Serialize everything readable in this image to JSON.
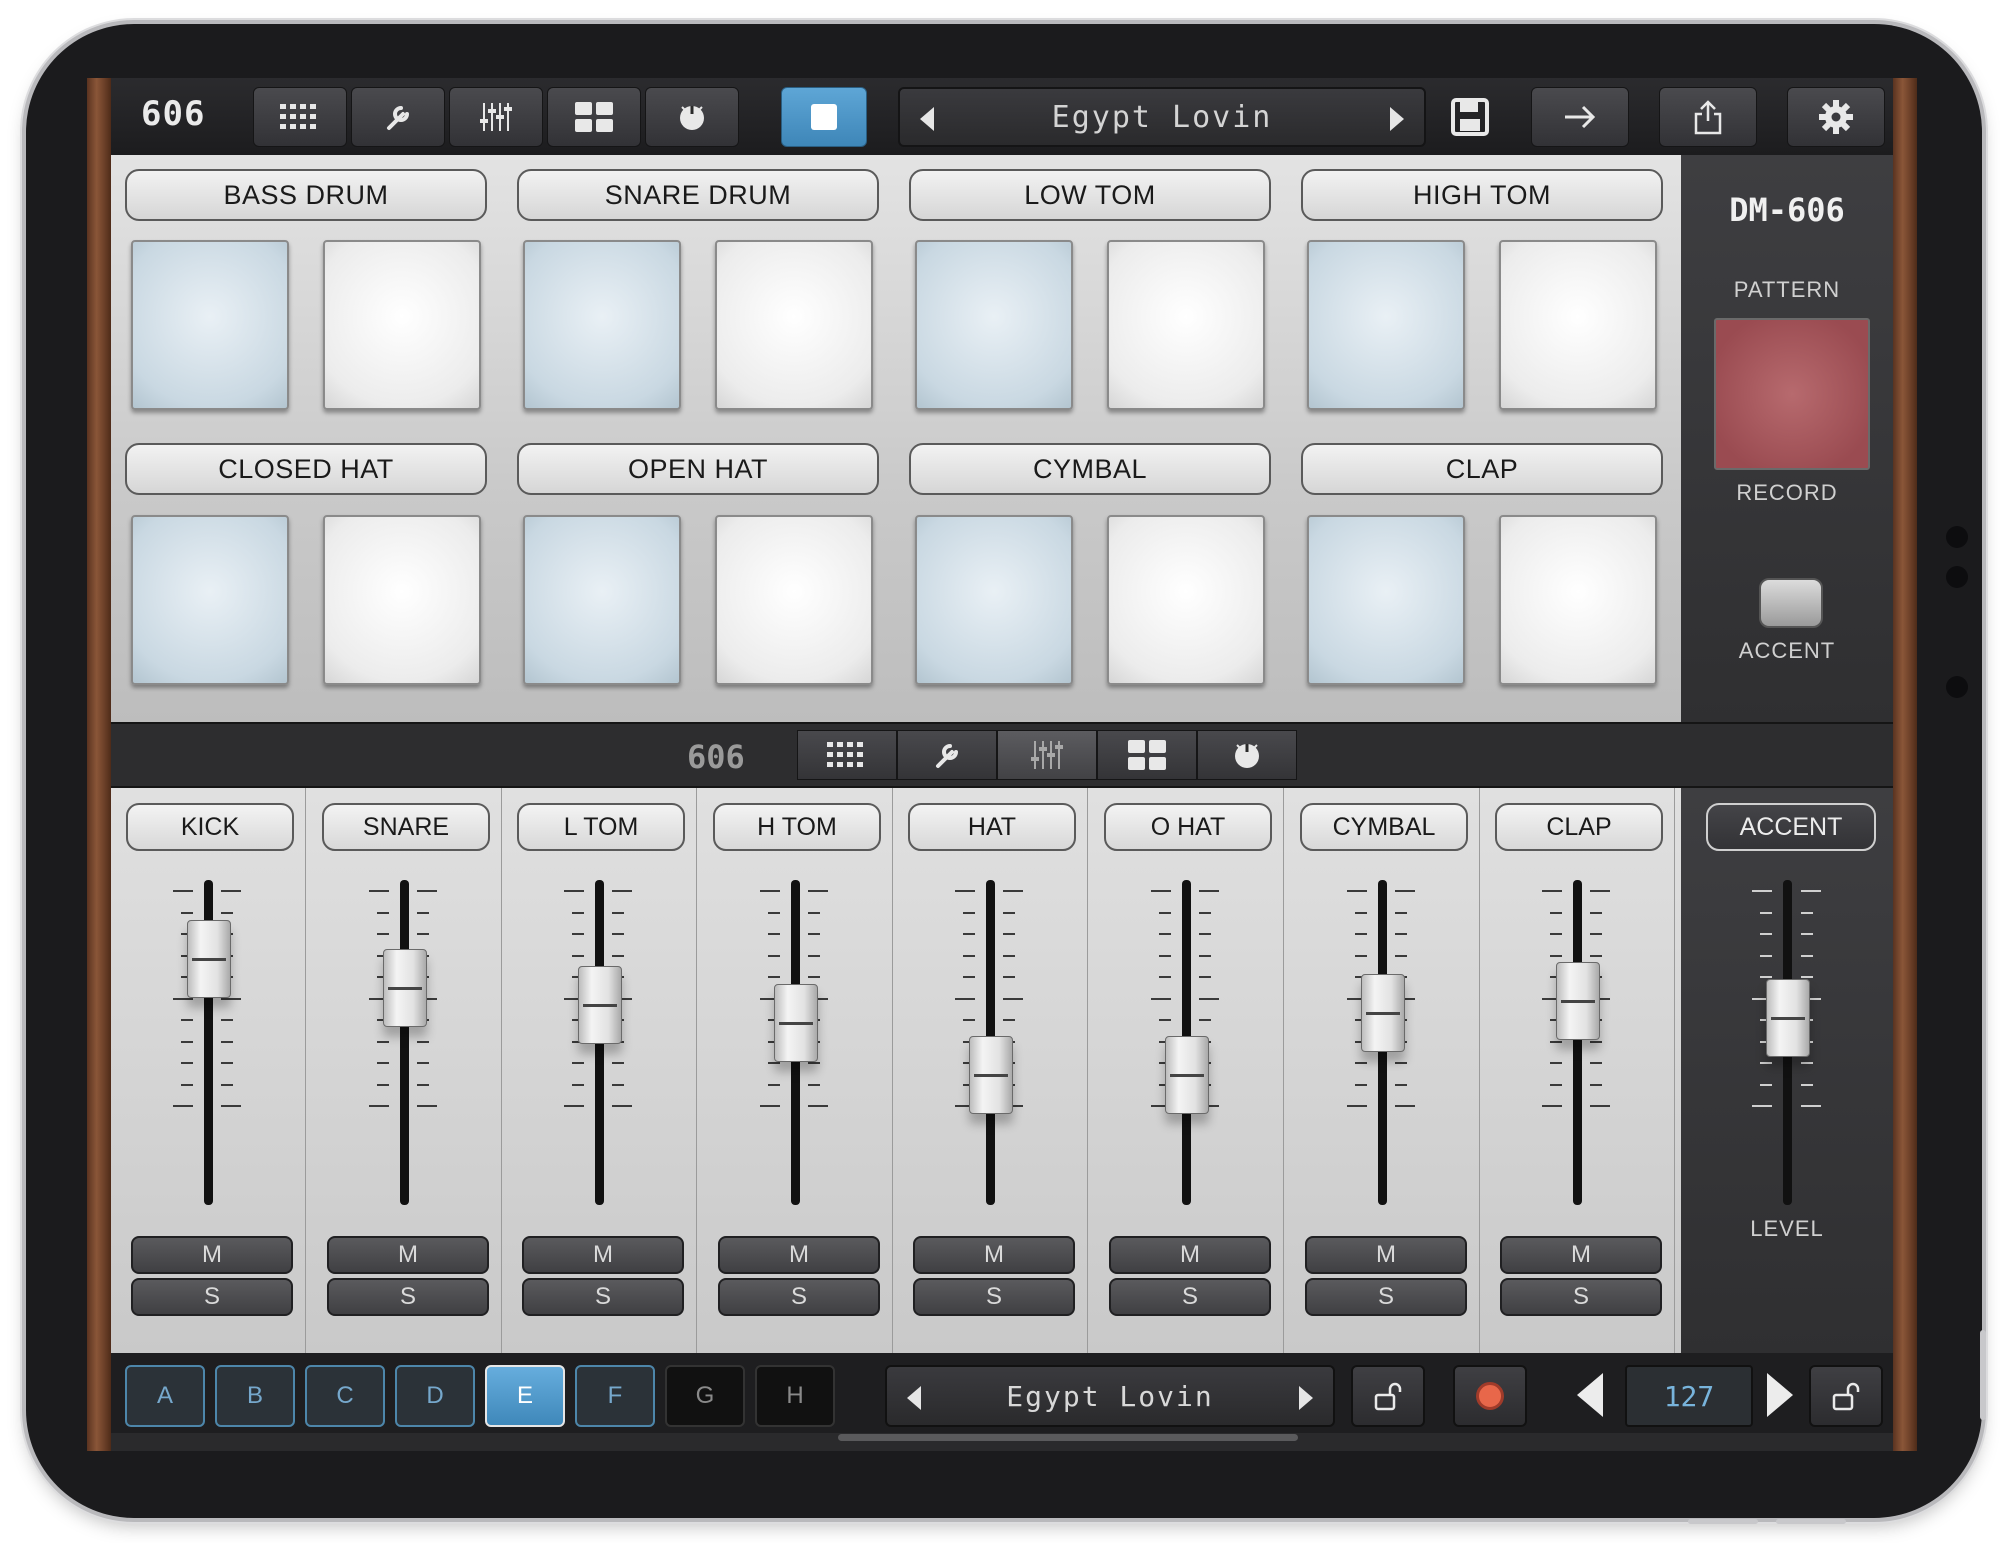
{
  "topbar": {
    "logo": "606",
    "pattern_name": "Egypt Lovin",
    "stop_label": "Stop"
  },
  "pads": {
    "row1_labels": [
      "BASS DRUM",
      "SNARE DRUM",
      "LOW TOM",
      "HIGH TOM"
    ],
    "row2_labels": [
      "CLOSED HAT",
      "OPEN HAT",
      "CYMBAL",
      "CLAP"
    ]
  },
  "right_panel": {
    "logo": "DM-606",
    "pattern_label": "PATTERN",
    "record_label": "RECORD",
    "accent_label": "ACCENT"
  },
  "midbar": {
    "logo": "606"
  },
  "mixer": {
    "channels": [
      {
        "label": "KICK",
        "level": 0.84,
        "mute": "M",
        "solo": "S"
      },
      {
        "label": "SNARE",
        "level": 0.72,
        "mute": "M",
        "solo": "S"
      },
      {
        "label": "L TOM",
        "level": 0.65,
        "mute": "M",
        "solo": "S"
      },
      {
        "label": "H TOM",
        "level": 0.58,
        "mute": "M",
        "solo": "S"
      },
      {
        "label": "HAT",
        "level": 0.37,
        "mute": "M",
        "solo": "S"
      },
      {
        "label": "O HAT",
        "level": 0.37,
        "mute": "M",
        "solo": "S"
      },
      {
        "label": "CYMBAL",
        "level": 0.62,
        "mute": "M",
        "solo": "S"
      },
      {
        "label": "CLAP",
        "level": 0.67,
        "mute": "M",
        "solo": "S"
      }
    ],
    "accent": {
      "label": "ACCENT",
      "level_label": "LEVEL",
      "level": 0.6
    }
  },
  "bottombar": {
    "banks": [
      "A",
      "B",
      "C",
      "D",
      "E",
      "F",
      "G",
      "H"
    ],
    "active_bank": "E",
    "pattern_name": "Egypt Lovin",
    "tempo": "127"
  },
  "colors": {
    "accent_blue": "#4a94c6",
    "record_red": "#a4545a",
    "record_dot": "#e8674a"
  }
}
